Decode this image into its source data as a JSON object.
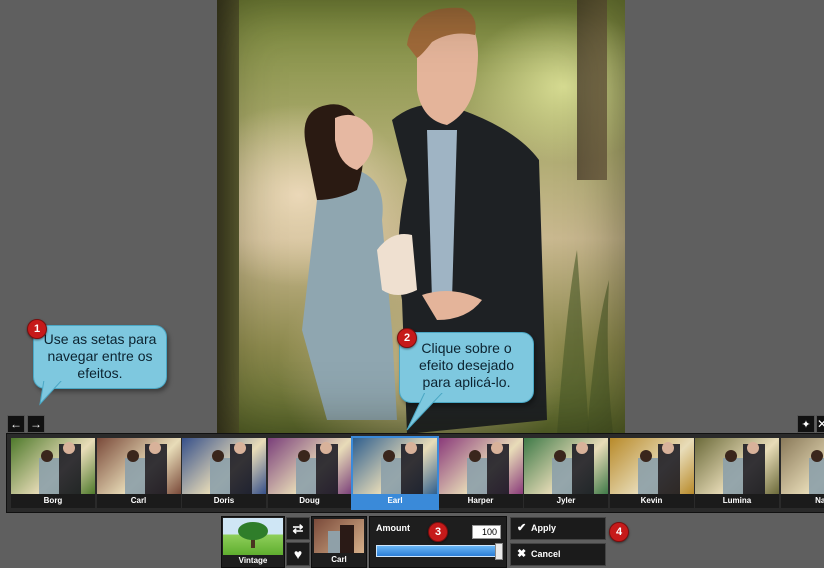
{
  "callouts": {
    "one": {
      "number": "1",
      "text": "Use as setas para navegar entre os efeitos."
    },
    "two": {
      "number": "2",
      "text": "Clique sobre o efeito desejado para aplicá-lo."
    },
    "three": {
      "number": "3"
    },
    "four": {
      "number": "4"
    }
  },
  "nav": {
    "prev_icon": "arrow-left-icon",
    "next_icon": "arrow-right-icon"
  },
  "toolbar_right": {
    "pin_icon": "pin-icon",
    "close_icon": "close-icon"
  },
  "effects": [
    {
      "label": "Borg",
      "tint": "#4f7a2c",
      "selected": false
    },
    {
      "label": "Carl",
      "tint": "#7a4a3a",
      "selected": false
    },
    {
      "label": "Doris",
      "tint": "#36508a",
      "selected": false
    },
    {
      "label": "Doug",
      "tint": "#7a3f7a",
      "selected": false
    },
    {
      "label": "Earl",
      "tint": "#2f5f8e",
      "selected": true
    },
    {
      "label": "Harper",
      "tint": "#8a3a7a",
      "selected": false
    },
    {
      "label": "Jyler",
      "tint": "#3f7a48",
      "selected": false
    },
    {
      "label": "Kevin",
      "tint": "#b88a2a",
      "selected": false
    },
    {
      "label": "Lumina",
      "tint": "#6b6a3a",
      "selected": false
    },
    {
      "label": "Nas",
      "tint": "#8a7a5a",
      "selected": false
    }
  ],
  "category": {
    "label": "Vintage"
  },
  "side_icons": {
    "shuffle": "shuffle-icon",
    "favorite": "heart-icon"
  },
  "current_effect": {
    "label": "Carl"
  },
  "amount": {
    "label": "Amount",
    "value": "100",
    "level": 1.0
  },
  "actions": {
    "apply": "Apply",
    "cancel": "Cancel"
  },
  "colors": {
    "badge": "#c61a1a",
    "bubble": "#7ec8df",
    "selection": "#3a8ad9"
  }
}
